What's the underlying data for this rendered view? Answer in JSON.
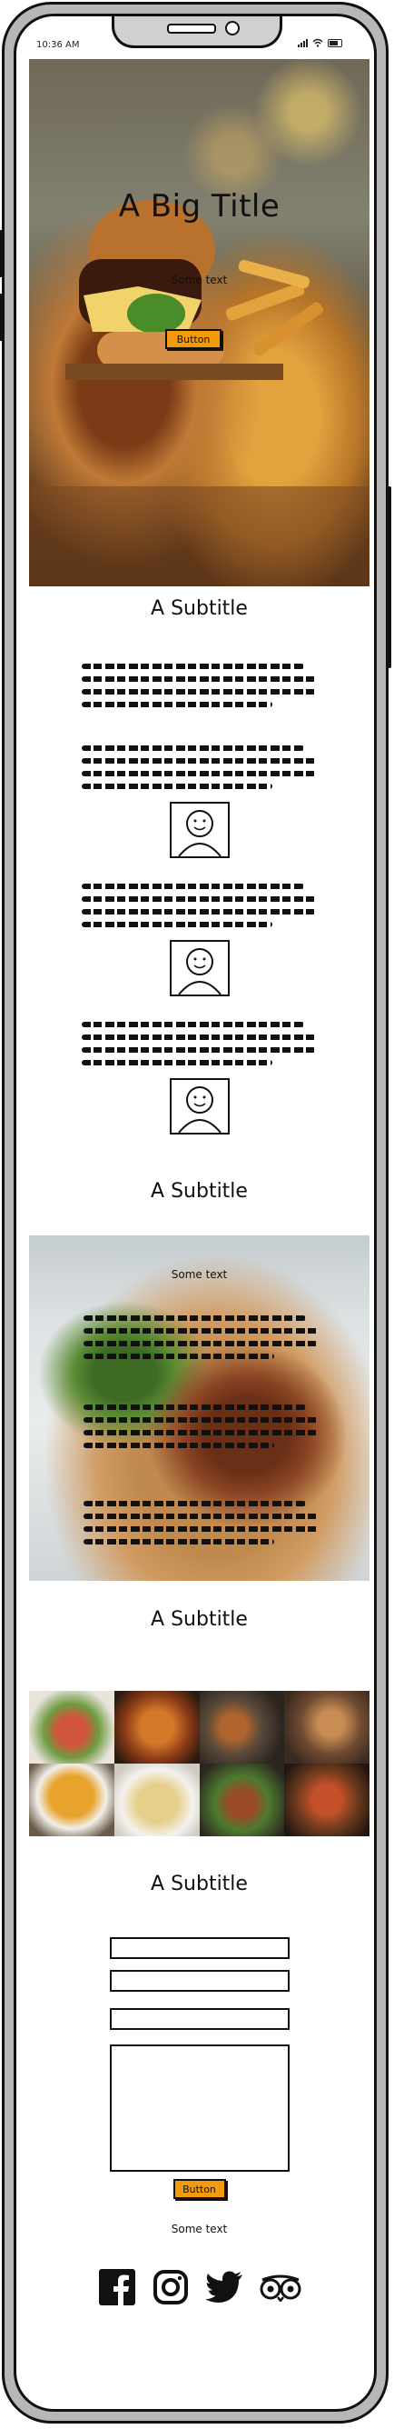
{
  "status_bar": {
    "time": "10:36 AM"
  },
  "hero": {
    "title": "A Big Title",
    "text": "Some text",
    "button_label": "Button"
  },
  "section_one": {
    "subtitle": "A Subtitle"
  },
  "section_two": {
    "subtitle": "A Subtitle"
  },
  "feature": {
    "text": "Some text"
  },
  "section_three": {
    "subtitle": "A Subtitle"
  },
  "contact": {
    "subtitle": "A Subtitle",
    "button_label": "Button"
  },
  "footer": {
    "text": "Some text"
  },
  "icons": {
    "facebook": "facebook-icon",
    "instagram": "instagram-icon",
    "twitter": "twitter-icon",
    "tripadvisor": "tripadvisor-icon"
  },
  "colors": {
    "accent": "#f59a0b",
    "outline": "#111111",
    "frame": "#b7b7b7"
  }
}
